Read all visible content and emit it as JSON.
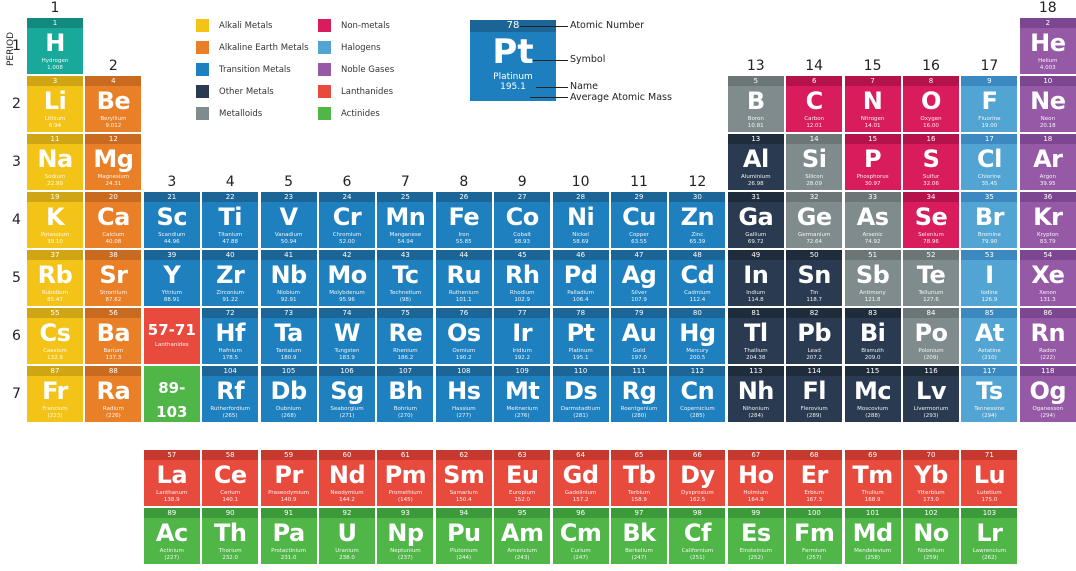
{
  "period_label": "PERIOD",
  "groups": [
    "1",
    "2",
    "3",
    "4",
    "5",
    "6",
    "7",
    "8",
    "9",
    "10",
    "11",
    "12",
    "13",
    "14",
    "15",
    "16",
    "17",
    "18"
  ],
  "periods": [
    "1",
    "2",
    "3",
    "4",
    "5",
    "6",
    "7"
  ],
  "colors": {
    "hydrogen": [
      "#18a99b",
      "#128a7f"
    ],
    "alkali": [
      "#f3c318",
      "#d0a514"
    ],
    "alkaline": [
      "#e97f27",
      "#c86b20"
    ],
    "transition": [
      "#1f80bf",
      "#1b6597"
    ],
    "other": [
      "#2a3b51",
      "#1f2c3c"
    ],
    "metalloid": [
      "#7f8b8c",
      "#6c7677"
    ],
    "nonmetal": [
      "#d91c5b",
      "#b3124a"
    ],
    "halogen": [
      "#52a4d2",
      "#3b89c0"
    ],
    "noble": [
      "#9559a6",
      "#7c4790"
    ],
    "lanthanide": [
      "#e84b3d",
      "#c6392e"
    ],
    "actinide": [
      "#50b648",
      "#3d9a3a"
    ]
  },
  "legend": [
    {
      "label": "Alkali Metals",
      "cat": "alkali"
    },
    {
      "label": "Alkaline Earth Metals",
      "cat": "alkaline"
    },
    {
      "label": "Transition Metals",
      "cat": "transition"
    },
    {
      "label": "Other Metals",
      "cat": "other"
    },
    {
      "label": "Metalloids",
      "cat": "metalloid"
    },
    {
      "label": "Non-metals",
      "cat": "nonmetal"
    },
    {
      "label": "Halogens",
      "cat": "halogen"
    },
    {
      "label": "Noble Gases",
      "cat": "noble"
    },
    {
      "label": "Lanthanides",
      "cat": "lanthanide"
    },
    {
      "label": "Actinides",
      "cat": "actinide"
    }
  ],
  "key": {
    "number": "78",
    "symbol": "Pt",
    "name": "Platinum",
    "mass": "195.1",
    "labels": {
      "number": "Atomic Number",
      "symbol": "Symbol",
      "name": "Name",
      "mass": "Average Atomic Mass"
    }
  },
  "placeholders": [
    {
      "range": "57-71",
      "label": "Lanthanides",
      "cat": "lanthanide",
      "period": 6,
      "group": 3
    },
    {
      "range": "89-103",
      "label": "Actinides",
      "cat": "actinide",
      "period": 7,
      "group": 3
    }
  ],
  "elements": [
    [
      1,
      "H",
      "Hydrogen",
      "1.008",
      "hydrogen",
      1,
      1
    ],
    [
      2,
      "He",
      "Helium",
      "4.003",
      "noble",
      1,
      18
    ],
    [
      3,
      "Li",
      "Lithium",
      "6.94",
      "alkali",
      2,
      1
    ],
    [
      4,
      "Be",
      "Beryllium",
      "9.012",
      "alkaline",
      2,
      2
    ],
    [
      5,
      "B",
      "Boron",
      "10.81",
      "metalloid",
      2,
      13
    ],
    [
      6,
      "C",
      "Carbon",
      "12.01",
      "nonmetal",
      2,
      14
    ],
    [
      7,
      "N",
      "Nitrogen",
      "14.01",
      "nonmetal",
      2,
      15
    ],
    [
      8,
      "O",
      "Oxygen",
      "16.00",
      "nonmetal",
      2,
      16
    ],
    [
      9,
      "F",
      "Fluorine",
      "19.00",
      "halogen",
      2,
      17
    ],
    [
      10,
      "Ne",
      "Neon",
      "20.18",
      "noble",
      2,
      18
    ],
    [
      11,
      "Na",
      "Sodium",
      "22.99",
      "alkali",
      3,
      1
    ],
    [
      12,
      "Mg",
      "Magnesium",
      "24.31",
      "alkaline",
      3,
      2
    ],
    [
      13,
      "Al",
      "Aluminium",
      "26.98",
      "other",
      3,
      13
    ],
    [
      14,
      "Si",
      "Silicon",
      "28.09",
      "metalloid",
      3,
      14
    ],
    [
      15,
      "P",
      "Phosphorus",
      "30.97",
      "nonmetal",
      3,
      15
    ],
    [
      16,
      "S",
      "Sulfur",
      "32.06",
      "nonmetal",
      3,
      16
    ],
    [
      17,
      "Cl",
      "Chlorine",
      "35.45",
      "halogen",
      3,
      17
    ],
    [
      18,
      "Ar",
      "Argon",
      "39.95",
      "noble",
      3,
      18
    ],
    [
      19,
      "K",
      "Potassium",
      "39.10",
      "alkali",
      4,
      1
    ],
    [
      20,
      "Ca",
      "Calcium",
      "40.08",
      "alkaline",
      4,
      2
    ],
    [
      21,
      "Sc",
      "Scandium",
      "44.96",
      "transition",
      4,
      3
    ],
    [
      22,
      "Ti",
      "Titanium",
      "47.88",
      "transition",
      4,
      4
    ],
    [
      23,
      "V",
      "Vanadium",
      "50.94",
      "transition",
      4,
      5
    ],
    [
      24,
      "Cr",
      "Chromium",
      "52.00",
      "transition",
      4,
      6
    ],
    [
      25,
      "Mn",
      "Manganese",
      "54.94",
      "transition",
      4,
      7
    ],
    [
      26,
      "Fe",
      "Iron",
      "55.85",
      "transition",
      4,
      8
    ],
    [
      27,
      "Co",
      "Cobalt",
      "58.93",
      "transition",
      4,
      9
    ],
    [
      28,
      "Ni",
      "Nickel",
      "58.69",
      "transition",
      4,
      10
    ],
    [
      29,
      "Cu",
      "Copper",
      "63.55",
      "transition",
      4,
      11
    ],
    [
      30,
      "Zn",
      "Zinc",
      "65.39",
      "transition",
      4,
      12
    ],
    [
      31,
      "Ga",
      "Gallium",
      "69.72",
      "other",
      4,
      13
    ],
    [
      32,
      "Ge",
      "Germanium",
      "72.64",
      "metalloid",
      4,
      14
    ],
    [
      33,
      "As",
      "Arsenic",
      "74.92",
      "metalloid",
      4,
      15
    ],
    [
      34,
      "Se",
      "Selenium",
      "78.96",
      "nonmetal",
      4,
      16
    ],
    [
      35,
      "Br",
      "Bromine",
      "79.90",
      "halogen",
      4,
      17
    ],
    [
      36,
      "Kr",
      "Krypton",
      "83.79",
      "noble",
      4,
      18
    ],
    [
      37,
      "Rb",
      "Rubidium",
      "85.47",
      "alkali",
      5,
      1
    ],
    [
      38,
      "Sr",
      "Strontium",
      "87.62",
      "alkaline",
      5,
      2
    ],
    [
      39,
      "Y",
      "Yttrium",
      "88.91",
      "transition",
      5,
      3
    ],
    [
      40,
      "Zr",
      "Zirconium",
      "91.22",
      "transition",
      5,
      4
    ],
    [
      41,
      "Nb",
      "Niobium",
      "92.91",
      "transition",
      5,
      5
    ],
    [
      42,
      "Mo",
      "Molybdenum",
      "95.96",
      "transition",
      5,
      6
    ],
    [
      43,
      "Tc",
      "Technetium",
      "(98)",
      "transition",
      5,
      7
    ],
    [
      44,
      "Ru",
      "Ruthenium",
      "101.1",
      "transition",
      5,
      8
    ],
    [
      45,
      "Rh",
      "Rhodium",
      "102.9",
      "transition",
      5,
      9
    ],
    [
      46,
      "Pd",
      "Palladium",
      "106.4",
      "transition",
      5,
      10
    ],
    [
      47,
      "Ag",
      "Silver",
      "107.9",
      "transition",
      5,
      11
    ],
    [
      48,
      "Cd",
      "Cadmium",
      "112.4",
      "transition",
      5,
      12
    ],
    [
      49,
      "In",
      "Indium",
      "114.8",
      "other",
      5,
      13
    ],
    [
      50,
      "Sn",
      "Tin",
      "118.7",
      "other",
      5,
      14
    ],
    [
      51,
      "Sb",
      "Antimony",
      "121.8",
      "metalloid",
      5,
      15
    ],
    [
      52,
      "Te",
      "Tellurium",
      "127.6",
      "metalloid",
      5,
      16
    ],
    [
      53,
      "I",
      "Iodine",
      "126.9",
      "halogen",
      5,
      17
    ],
    [
      54,
      "Xe",
      "Xenon",
      "131.3",
      "noble",
      5,
      18
    ],
    [
      55,
      "Cs",
      "Caesium",
      "132.9",
      "alkali",
      6,
      1
    ],
    [
      56,
      "Ba",
      "Barium",
      "137.3",
      "alkaline",
      6,
      2
    ],
    [
      72,
      "Hf",
      "Hafnium",
      "178.5",
      "transition",
      6,
      4
    ],
    [
      73,
      "Ta",
      "Tantalum",
      "180.9",
      "transition",
      6,
      5
    ],
    [
      74,
      "W",
      "Tungsten",
      "183.9",
      "transition",
      6,
      6
    ],
    [
      75,
      "Re",
      "Rhenium",
      "186.2",
      "transition",
      6,
      7
    ],
    [
      76,
      "Os",
      "Osmium",
      "190.2",
      "transition",
      6,
      8
    ],
    [
      77,
      "Ir",
      "Iridium",
      "192.2",
      "transition",
      6,
      9
    ],
    [
      78,
      "Pt",
      "Platinum",
      "195.1",
      "transition",
      6,
      10
    ],
    [
      79,
      "Au",
      "Gold",
      "197.0",
      "transition",
      6,
      11
    ],
    [
      80,
      "Hg",
      "Mercury",
      "200.5",
      "transition",
      6,
      12
    ],
    [
      81,
      "Tl",
      "Thallium",
      "204.38",
      "other",
      6,
      13
    ],
    [
      82,
      "Pb",
      "Lead",
      "207.2",
      "other",
      6,
      14
    ],
    [
      83,
      "Bi",
      "Bismuth",
      "209.0",
      "other",
      6,
      15
    ],
    [
      84,
      "Po",
      "Polonium",
      "(209)",
      "metalloid",
      6,
      16
    ],
    [
      85,
      "At",
      "Astatine",
      "(210)",
      "halogen",
      6,
      17
    ],
    [
      86,
      "Rn",
      "Radon",
      "(222)",
      "noble",
      6,
      18
    ],
    [
      87,
      "Fr",
      "Francium",
      "(223)",
      "alkali",
      7,
      1
    ],
    [
      88,
      "Ra",
      "Radium",
      "(226)",
      "alkaline",
      7,
      2
    ],
    [
      104,
      "Rf",
      "Rutherfordium",
      "(265)",
      "transition",
      7,
      4
    ],
    [
      105,
      "Db",
      "Dubnium",
      "(268)",
      "transition",
      7,
      5
    ],
    [
      106,
      "Sg",
      "Seaborgium",
      "(271)",
      "transition",
      7,
      6
    ],
    [
      107,
      "Bh",
      "Bohrium",
      "(270)",
      "transition",
      7,
      7
    ],
    [
      108,
      "Hs",
      "Hassium",
      "(277)",
      "transition",
      7,
      8
    ],
    [
      109,
      "Mt",
      "Meitnerium",
      "(276)",
      "transition",
      7,
      9
    ],
    [
      110,
      "Ds",
      "Darmstadtium",
      "(281)",
      "transition",
      7,
      10
    ],
    [
      111,
      "Rg",
      "Roentgenium",
      "(280)",
      "transition",
      7,
      11
    ],
    [
      112,
      "Cn",
      "Copernicium",
      "(285)",
      "transition",
      7,
      12
    ],
    [
      113,
      "Nh",
      "Nihonium",
      "(284)",
      "other",
      7,
      13
    ],
    [
      114,
      "Fl",
      "Flerovium",
      "(289)",
      "other",
      7,
      14
    ],
    [
      115,
      "Mc",
      "Moscovium",
      "(288)",
      "other",
      7,
      15
    ],
    [
      116,
      "Lv",
      "Livermorium",
      "(293)",
      "other",
      7,
      16
    ],
    [
      117,
      "Ts",
      "Tennessine",
      "(294)",
      "halogen",
      7,
      17
    ],
    [
      118,
      "Og",
      "Oganesson",
      "(294)",
      "noble",
      7,
      18
    ]
  ],
  "lanthanides": [
    [
      57,
      "La",
      "Lanthanum",
      "138.9"
    ],
    [
      58,
      "Ce",
      "Cerium",
      "140.1"
    ],
    [
      59,
      "Pr",
      "Praseodymium",
      "140.9"
    ],
    [
      60,
      "Nd",
      "Neodymium",
      "144.2"
    ],
    [
      61,
      "Pm",
      "Promethium",
      "(145)"
    ],
    [
      62,
      "Sm",
      "Samarium",
      "150.4"
    ],
    [
      63,
      "Eu",
      "Europium",
      "152.0"
    ],
    [
      64,
      "Gd",
      "Gadolinium",
      "157.2"
    ],
    [
      65,
      "Tb",
      "Terbium",
      "158.9"
    ],
    [
      66,
      "Dy",
      "Dysprosium",
      "162.5"
    ],
    [
      67,
      "Ho",
      "Holmium",
      "164.9"
    ],
    [
      68,
      "Er",
      "Erbium",
      "167.3"
    ],
    [
      69,
      "Tm",
      "Thulium",
      "168.9"
    ],
    [
      70,
      "Yb",
      "Ytterbium",
      "173.0"
    ],
    [
      71,
      "Lu",
      "Lutetium",
      "175.0"
    ]
  ],
  "actinides": [
    [
      89,
      "Ac",
      "Actinium",
      "(227)"
    ],
    [
      90,
      "Th",
      "Thorium",
      "232.0"
    ],
    [
      91,
      "Pa",
      "Protactinium",
      "231.0"
    ],
    [
      92,
      "U",
      "Uranium",
      "238.0"
    ],
    [
      93,
      "Np",
      "Neptunium",
      "(237)"
    ],
    [
      94,
      "Pu",
      "Plutonium",
      "(244)"
    ],
    [
      95,
      "Am",
      "Americium",
      "(243)"
    ],
    [
      96,
      "Cm",
      "Curium",
      "(247)"
    ],
    [
      97,
      "Bk",
      "Berkelium",
      "(247)"
    ],
    [
      98,
      "Cf",
      "Californium",
      "(251)"
    ],
    [
      99,
      "Es",
      "Einsteinium",
      "(252)"
    ],
    [
      100,
      "Fm",
      "Fermium",
      "(257)"
    ],
    [
      101,
      "Md",
      "Mendelevium",
      "(258)"
    ],
    [
      102,
      "No",
      "Nobelium",
      "(259)"
    ],
    [
      103,
      "Lr",
      "Lawrencium",
      "(262)"
    ]
  ]
}
